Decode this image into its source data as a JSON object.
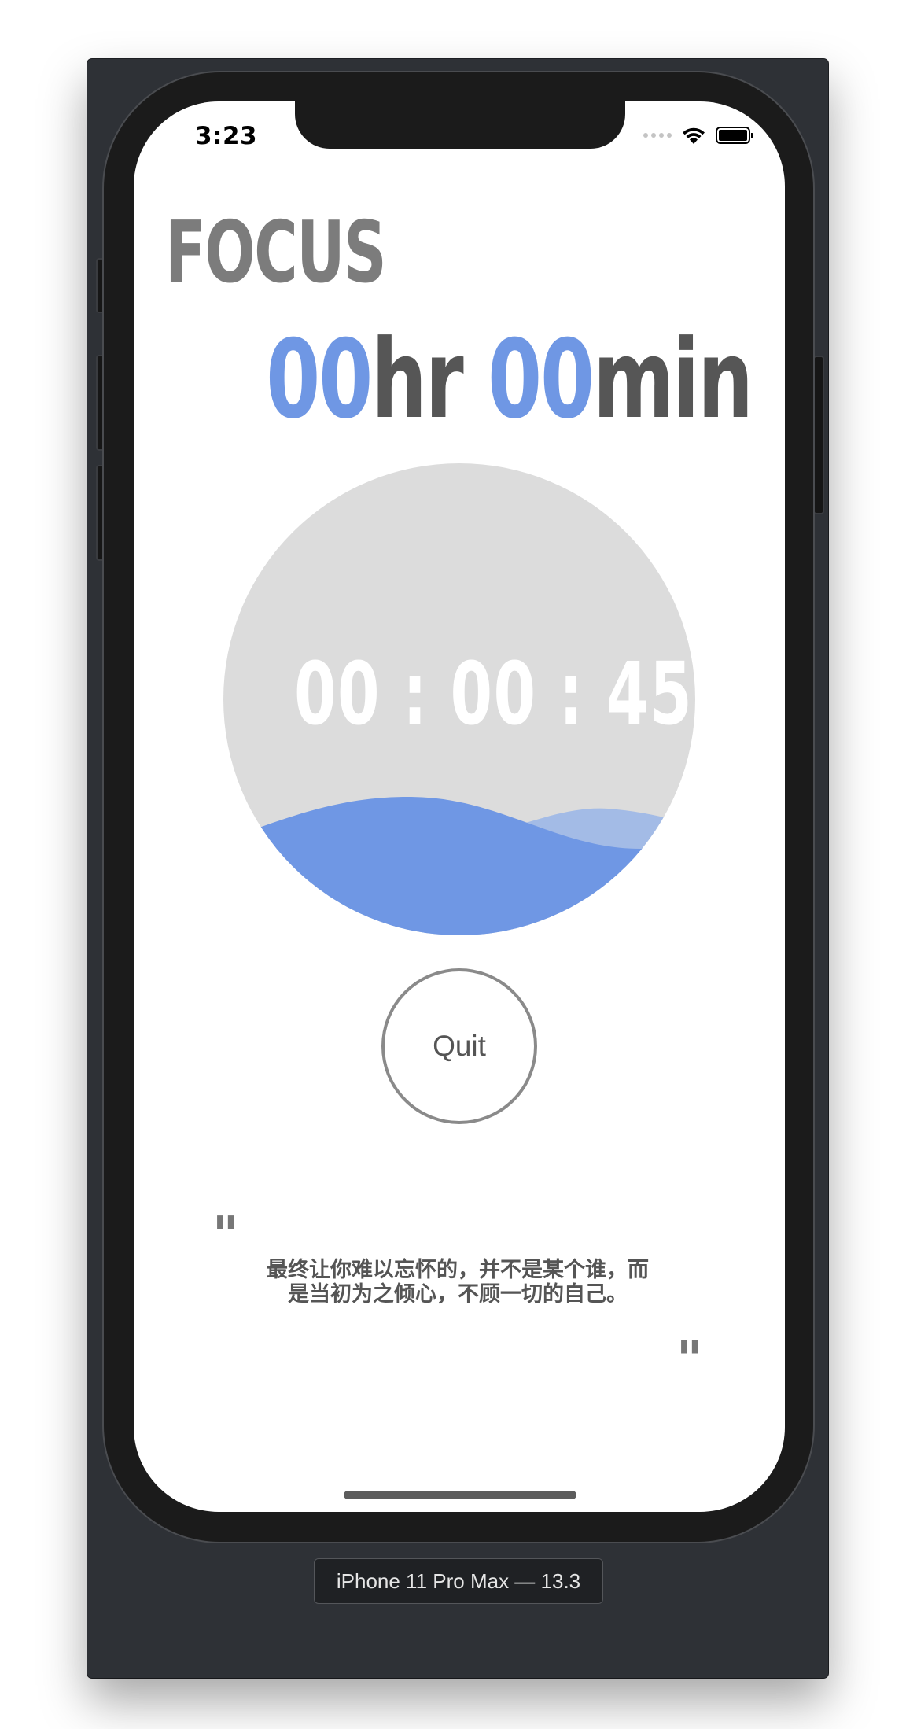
{
  "status_bar": {
    "time": "3:23"
  },
  "app": {
    "title": "FOCUS",
    "duration": {
      "hours": "00",
      "hours_unit": "hr",
      "minutes": "00",
      "minutes_unit": "min"
    },
    "timer": {
      "display": "00 : 00 : 45"
    },
    "quit_label": "Quit",
    "quote": {
      "open_mark": "\"",
      "text": "最终让你难以忘怀的，并不是某个谁，而是当初为之倾心，不顾一切的自己。",
      "close_mark": "\""
    }
  },
  "simulator": {
    "device_label": "iPhone 11 Pro Max — 13.3"
  },
  "colors": {
    "accent_blue": "#6f97e4",
    "wave_light": "#a3bbe6",
    "circle_bg": "#dcdcdc",
    "title_gray": "#7c7c7c"
  }
}
